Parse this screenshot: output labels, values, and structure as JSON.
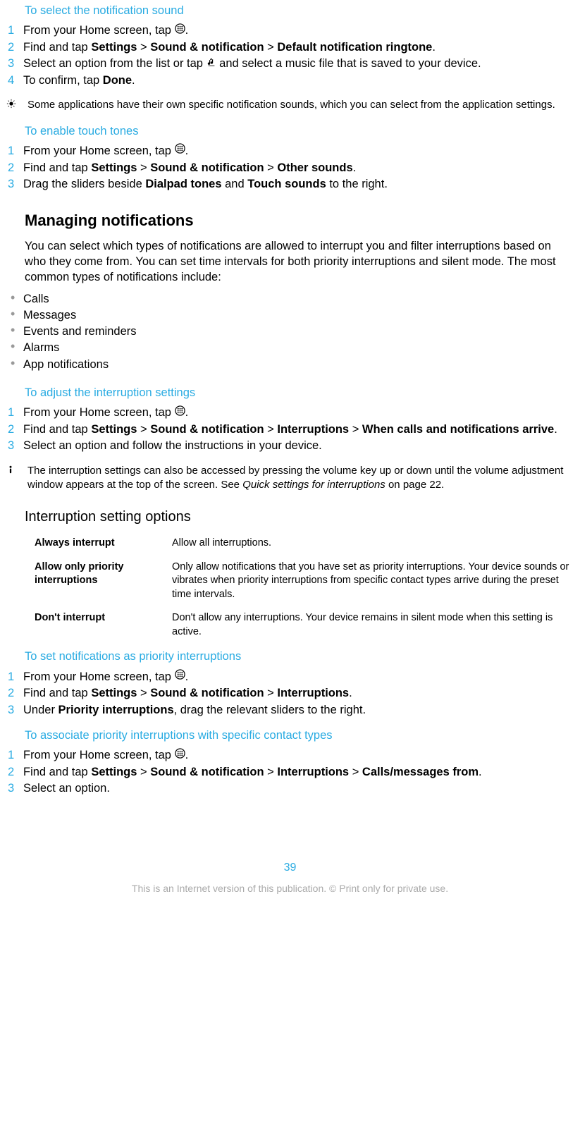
{
  "sec1": {
    "title": "To select the notification sound",
    "steps": [
      {
        "pre": "From your Home screen, tap ",
        "icon": "apps",
        "post": "."
      },
      {
        "pre": "Find and tap ",
        "b1": "Settings",
        "gt1": " > ",
        "b2": "Sound & notification",
        "gt2": " > ",
        "b3": "Default notification ringtone",
        "post": "."
      },
      {
        "pre": "Select an option from the list or tap ",
        "icon": "music",
        "post": " and select a music file that is saved to your device."
      },
      {
        "pre": "To confirm, tap ",
        "b1": "Done",
        "post": "."
      }
    ],
    "note": "Some applications have their own specific notification sounds, which you can select from the application settings."
  },
  "sec2": {
    "title": "To enable touch tones",
    "steps": [
      {
        "pre": "From your Home screen, tap ",
        "icon": "apps",
        "post": "."
      },
      {
        "pre": "Find and tap ",
        "b1": "Settings",
        "gt1": " > ",
        "b2": "Sound & notification",
        "gt2": " > ",
        "b3": "Other sounds",
        "post": "."
      },
      {
        "pre": "Drag the sliders beside ",
        "b1": "Dialpad tones",
        "mid": " and ",
        "b2": "Touch sounds",
        "post": " to the right."
      }
    ]
  },
  "managing": {
    "heading": "Managing notifications",
    "para": "You can select which types of notifications are allowed to interrupt you and filter interruptions based on who they come from. You can set time intervals for both priority interruptions and silent mode. The most common types of notifications include:",
    "bullets": [
      "Calls",
      "Messages",
      "Events and reminders",
      "Alarms",
      "App notifications"
    ]
  },
  "sec3": {
    "title": "To adjust the interruption settings",
    "steps": [
      {
        "pre": "From your Home screen, tap ",
        "icon": "apps",
        "post": "."
      },
      {
        "pre": "Find and tap ",
        "b1": "Settings",
        "gt1": " > ",
        "b2": "Sound & notification",
        "gt2": " > ",
        "b3": "Interruptions",
        "gt3": " > ",
        "b4": "When calls and notifications arrive",
        "post": "."
      },
      {
        "pre": "Select an option and follow the instructions in your device.",
        "post": ""
      }
    ],
    "note_pre": "The interruption settings can also be accessed by pressing the volume key up or down until the volume adjustment window appears at the top of the screen. See ",
    "note_italic": "Quick settings for interruptions",
    "note_post": " on page 22."
  },
  "options": {
    "heading": "Interruption setting options",
    "rows": [
      {
        "label": "Always interrupt",
        "desc": "Allow all interruptions."
      },
      {
        "label": "Allow only priority interruptions",
        "desc": "Only allow notifications that you have set as priority interruptions. Your device sounds or vibrates when priority interruptions from specific contact types arrive during the preset time intervals."
      },
      {
        "label": "Don't interrupt",
        "desc": "Don't allow any interruptions. Your device remains in silent mode when this setting is active."
      }
    ]
  },
  "sec4": {
    "title": "To set notifications as priority interruptions",
    "steps": [
      {
        "pre": "From your Home screen, tap ",
        "icon": "apps",
        "post": "."
      },
      {
        "pre": "Find and tap ",
        "b1": "Settings",
        "gt1": " > ",
        "b2": "Sound & notification",
        "gt2": " > ",
        "b3": "Interruptions",
        "post": "."
      },
      {
        "pre": "Under ",
        "b1": "Priority interruptions",
        "post": ", drag the relevant sliders to the right."
      }
    ]
  },
  "sec5": {
    "title": "To associate priority interruptions with specific contact types",
    "steps": [
      {
        "pre": "From your Home screen, tap ",
        "icon": "apps",
        "post": "."
      },
      {
        "pre": "Find and tap ",
        "b1": "Settings",
        "gt1": " > ",
        "b2": "Sound & notification",
        "gt2": " > ",
        "b3": "Interruptions",
        "gt3": " > ",
        "b4": "Calls/messages from",
        "post": "."
      },
      {
        "pre": "Select an option.",
        "post": ""
      }
    ]
  },
  "pagenum": "39",
  "footer": "This is an Internet version of this publication. © Print only for private use."
}
